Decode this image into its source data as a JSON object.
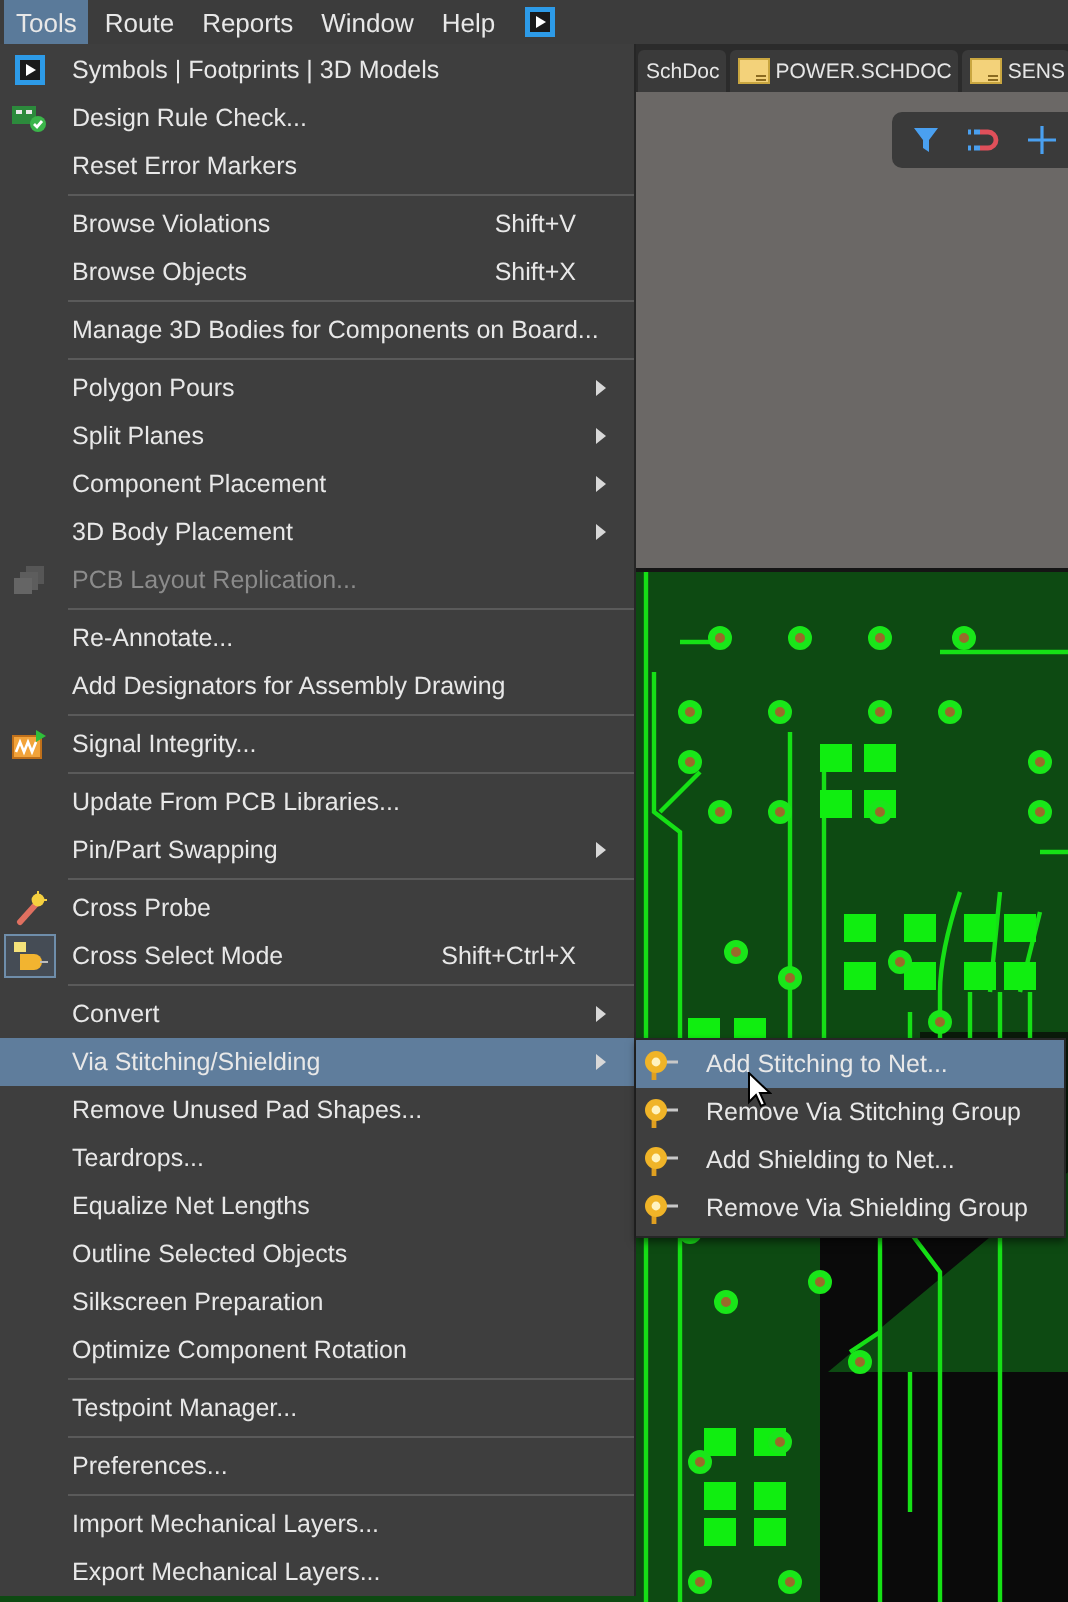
{
  "menubar": [
    {
      "label": "Tools",
      "selected": true
    },
    {
      "label": "Route",
      "selected": false
    },
    {
      "label": "Reports",
      "selected": false
    },
    {
      "label": "Window",
      "selected": false
    },
    {
      "label": "Help",
      "selected": false
    }
  ],
  "tabs": [
    {
      "label": "SchDoc"
    },
    {
      "label": "POWER.SCHDOC"
    },
    {
      "label": "SENS"
    }
  ],
  "menu": {
    "items": [
      {
        "kind": "item",
        "label": "Symbols | Footprints | 3D Models",
        "selected": false,
        "disabled": false,
        "checked": false
      },
      {
        "kind": "item",
        "label": "Design Rule Check...",
        "selected": false,
        "disabled": false,
        "checked": false
      },
      {
        "kind": "item",
        "label": "Reset Error Markers",
        "selected": false,
        "disabled": false,
        "checked": false
      },
      {
        "kind": "separator"
      },
      {
        "kind": "item",
        "label": "Browse Violations",
        "shortcut": "Shift+V",
        "selected": false,
        "disabled": false,
        "checked": false
      },
      {
        "kind": "item",
        "label": "Browse Objects",
        "shortcut": "Shift+X",
        "selected": false,
        "disabled": false,
        "checked": false
      },
      {
        "kind": "separator"
      },
      {
        "kind": "item",
        "label": "Manage 3D Bodies for Components on Board...",
        "selected": false,
        "disabled": false,
        "checked": false
      },
      {
        "kind": "separator"
      },
      {
        "kind": "item",
        "label": "Polygon Pours",
        "submenu": true,
        "selected": false,
        "disabled": false,
        "checked": false
      },
      {
        "kind": "item",
        "label": "Split Planes",
        "submenu": true,
        "selected": false,
        "disabled": false,
        "checked": false
      },
      {
        "kind": "item",
        "label": "Component Placement",
        "submenu": true,
        "selected": false,
        "disabled": false,
        "checked": false
      },
      {
        "kind": "item",
        "label": "3D Body Placement",
        "submenu": true,
        "selected": false,
        "disabled": false,
        "checked": false
      },
      {
        "kind": "item",
        "label": "PCB Layout Replication...",
        "selected": false,
        "disabled": true,
        "checked": false
      },
      {
        "kind": "separator"
      },
      {
        "kind": "item",
        "label": "Re-Annotate...",
        "selected": false,
        "disabled": false,
        "checked": false
      },
      {
        "kind": "item",
        "label": "Add Designators for Assembly Drawing",
        "selected": false,
        "disabled": false,
        "checked": false
      },
      {
        "kind": "separator"
      },
      {
        "kind": "item",
        "label": "Signal Integrity...",
        "selected": false,
        "disabled": false,
        "checked": false
      },
      {
        "kind": "separator"
      },
      {
        "kind": "item",
        "label": "Update From PCB Libraries...",
        "selected": false,
        "disabled": false,
        "checked": false
      },
      {
        "kind": "item",
        "label": "Pin/Part Swapping",
        "submenu": true,
        "selected": false,
        "disabled": false,
        "checked": false
      },
      {
        "kind": "separator"
      },
      {
        "kind": "item",
        "label": "Cross Probe",
        "selected": false,
        "disabled": false,
        "checked": false
      },
      {
        "kind": "item",
        "label": "Cross Select Mode",
        "shortcut": "Shift+Ctrl+X",
        "selected": false,
        "disabled": false,
        "checked": true
      },
      {
        "kind": "separator"
      },
      {
        "kind": "item",
        "label": "Convert",
        "submenu": true,
        "selected": false,
        "disabled": false,
        "checked": false
      },
      {
        "kind": "item",
        "label": "Via Stitching/Shielding",
        "submenu": true,
        "selected": true,
        "disabled": false,
        "checked": false
      },
      {
        "kind": "item",
        "label": "Remove Unused Pad Shapes...",
        "selected": false,
        "disabled": false,
        "checked": false
      },
      {
        "kind": "item",
        "label": "Teardrops...",
        "selected": false,
        "disabled": false,
        "checked": false
      },
      {
        "kind": "item",
        "label": "Equalize Net Lengths",
        "selected": false,
        "disabled": false,
        "checked": false
      },
      {
        "kind": "item",
        "label": "Outline Selected Objects",
        "selected": false,
        "disabled": false,
        "checked": false
      },
      {
        "kind": "item",
        "label": "Silkscreen Preparation",
        "selected": false,
        "disabled": false,
        "checked": false
      },
      {
        "kind": "item",
        "label": "Optimize Component Rotation",
        "selected": false,
        "disabled": false,
        "checked": false
      },
      {
        "kind": "separator"
      },
      {
        "kind": "item",
        "label": "Testpoint Manager...",
        "selected": false,
        "disabled": false,
        "checked": false
      },
      {
        "kind": "separator"
      },
      {
        "kind": "item",
        "label": "Preferences...",
        "selected": false,
        "disabled": false,
        "checked": false
      },
      {
        "kind": "separator"
      },
      {
        "kind": "item",
        "label": "Import Mechanical Layers...",
        "selected": false,
        "disabled": false,
        "checked": false
      },
      {
        "kind": "item",
        "label": "Export Mechanical Layers...",
        "selected": false,
        "disabled": false,
        "checked": false
      }
    ]
  },
  "submenu": {
    "items": [
      {
        "label": "Add Stitching to Net...",
        "selected": true
      },
      {
        "label": "Remove Via Stitching Group",
        "selected": false
      },
      {
        "label": "Add Shielding to Net...",
        "selected": false
      },
      {
        "label": "Remove Via Shielding Group",
        "selected": false
      }
    ]
  }
}
